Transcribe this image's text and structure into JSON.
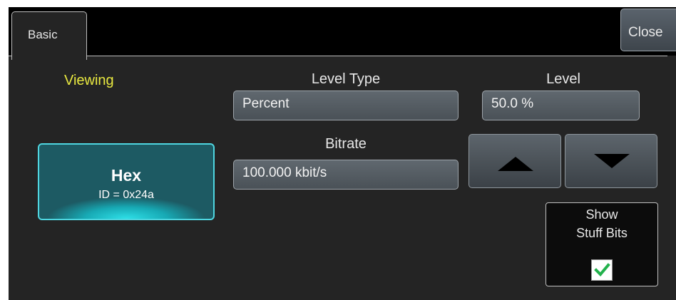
{
  "tabs": [
    {
      "label": "Basic",
      "active": true
    }
  ],
  "toolbar": {
    "close_label": "Close"
  },
  "viewing": {
    "label": "Viewing",
    "button_title": "Hex",
    "button_subtitle": "ID = 0x24a"
  },
  "level_type": {
    "label": "Level Type",
    "value": "Percent"
  },
  "level": {
    "label": "Level",
    "value": "50.0 %"
  },
  "bitrate": {
    "label": "Bitrate",
    "value": "100.000 kbit/s"
  },
  "stepper": {
    "up_icon": "triangle-up-icon",
    "down_icon": "triangle-down-icon"
  },
  "stuff_bits": {
    "line1": "Show",
    "line2": "Stuff Bits",
    "checked": true
  },
  "colors": {
    "background": "#242424",
    "viewing_label": "#e8e840",
    "hex_accent": "#2ee0e8",
    "checkmark": "#22b14c"
  }
}
